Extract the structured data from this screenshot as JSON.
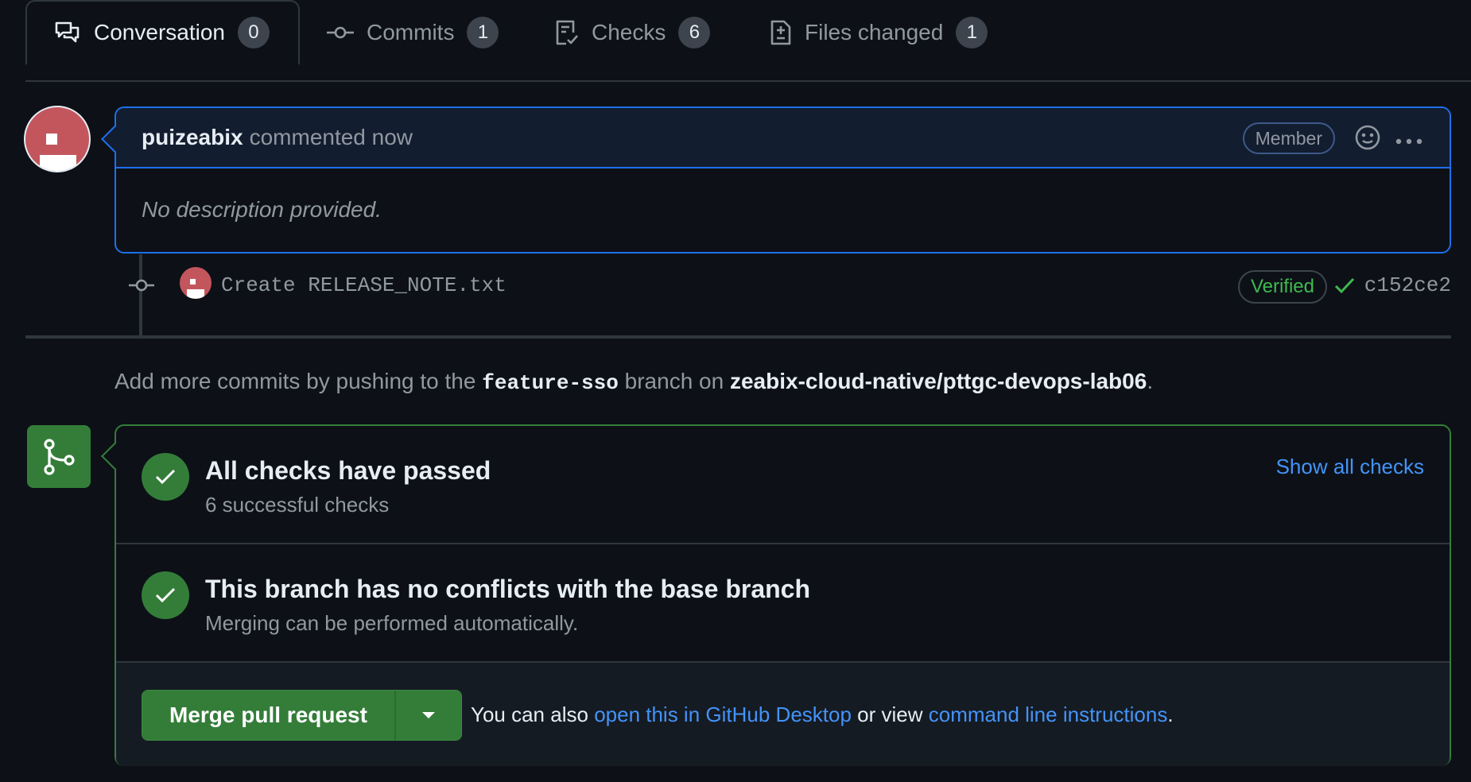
{
  "tabs": [
    {
      "label": "Conversation",
      "count": "0",
      "icon": "comment-discussion-icon"
    },
    {
      "label": "Commits",
      "count": "1",
      "icon": "git-commit-icon"
    },
    {
      "label": "Checks",
      "count": "6",
      "icon": "checklist-icon"
    },
    {
      "label": "Files changed",
      "count": "1",
      "icon": "file-diff-icon"
    }
  ],
  "comment": {
    "author": "puizeabix",
    "action": "commented now",
    "badge": "Member",
    "body": "No description provided."
  },
  "commit": {
    "message": "Create RELEASE_NOTE.txt",
    "verified": "Verified",
    "sha": "c152ce2"
  },
  "push_note": {
    "prefix": "Add more commits by pushing to the",
    "branch": "feature-sso",
    "middle": "branch on",
    "repo": "zeabix-cloud-native/pttgc-devops-lab06",
    "suffix": "."
  },
  "merge": {
    "checks_title": "All checks have passed",
    "checks_sub": "6 successful checks",
    "show_all": "Show all checks",
    "conflicts_title": "This branch has no conflicts with the base branch",
    "conflicts_sub": "Merging can be performed automatically.",
    "merge_button": "Merge pull request",
    "also_prefix": "You can also",
    "desktop_link": "open this in GitHub Desktop",
    "also_middle": "or view",
    "cli_link": "command line instructions",
    "also_suffix": "."
  },
  "colors": {
    "accent_blue": "#1f6feb",
    "success_green": "#347d39",
    "link_blue": "#4493f8",
    "avatar_red": "#c3565d"
  }
}
